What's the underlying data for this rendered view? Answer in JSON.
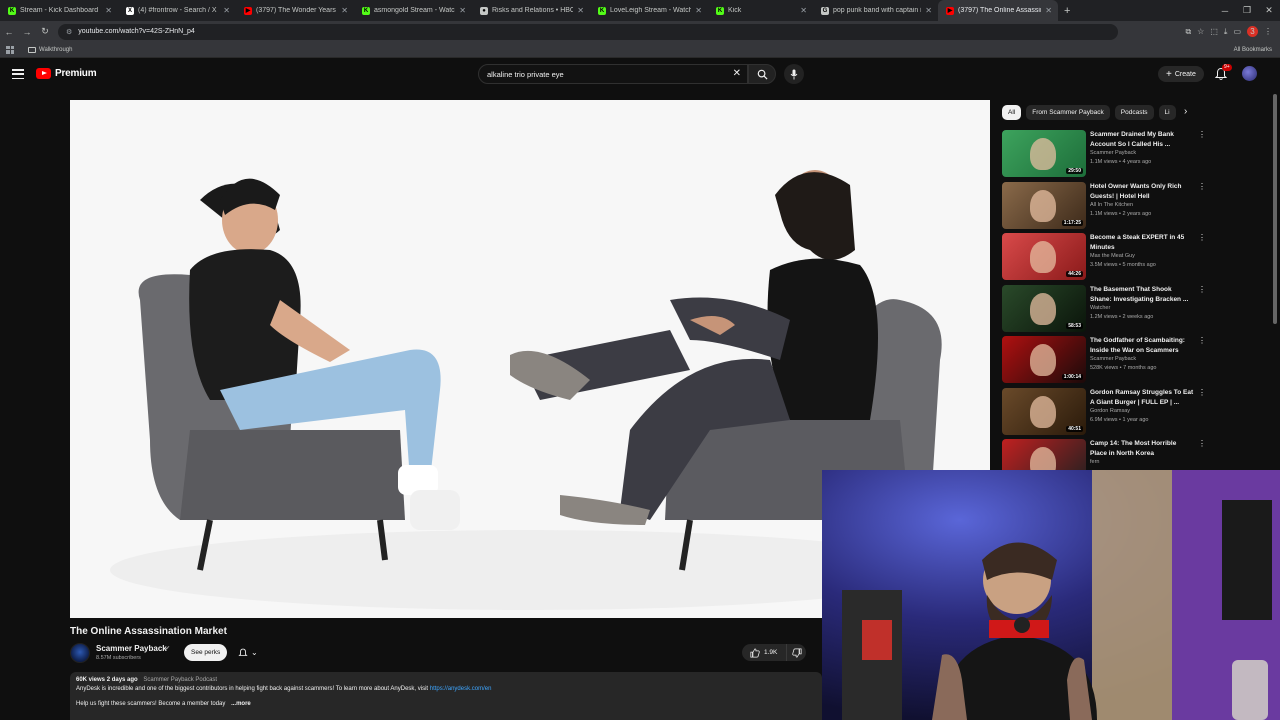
{
  "browser": {
    "tabs": [
      {
        "label": "Stream - Kick Dashboard",
        "fav_color": "#53fc18",
        "fav_char": "K"
      },
      {
        "label": "(4) #frontrow - Search / X",
        "fav_color": "#ffffff",
        "fav_char": "X"
      },
      {
        "label": "(3797) The Wonder Years - Loca",
        "fav_color": "#ff0000",
        "fav_char": "▶"
      },
      {
        "label": "asmongold Stream - Watch Live",
        "fav_color": "#53fc18",
        "fav_char": "K"
      },
      {
        "label": "Risks and Relations • HBO Max",
        "fav_color": "#c4c7c5",
        "fav_char": "●"
      },
      {
        "label": "LoveLeigh Stream - Watch Live",
        "fav_color": "#53fc18",
        "fav_char": "K"
      },
      {
        "label": "Kick",
        "fav_color": "#53fc18",
        "fav_char": "K"
      },
      {
        "label": "pop punk band with captain in",
        "fav_color": "#c4c7c5",
        "fav_char": "G"
      },
      {
        "label": "(3797) The Online Assassin",
        "fav_color": "#ff0000",
        "fav_char": "▶"
      }
    ],
    "url": "youtube.com/watch?v=42S-ZHnN_p4",
    "bookmark_folder": "Walkthrough",
    "all_bookmarks": "All Bookmarks",
    "profile_badge": "3"
  },
  "youtube": {
    "logo_text": "Premium",
    "search_query": "alkaline trio private eye",
    "create_label": "Create",
    "notif_badge": "9+",
    "video": {
      "title": "The Online Assassination Market",
      "channel": "Scammer Payback",
      "subscribers": "8.57M subscribers",
      "perks_label": "See perks",
      "likes": "1.9K",
      "views": "60K views",
      "age": "2 days ago",
      "podcast_tag": "Scammer Payback Podcast",
      "desc_line1": "AnyDesk is incredible and one of the biggest contributors in helping fight back against scammers! To learn more about AnyDesk, visit",
      "desc_link": "https://anydesk.com/en",
      "desc_line2": "Help us fight these scammers! Become a member today",
      "more_label": "...more"
    },
    "chips": [
      "All",
      "From Scammer Payback",
      "Podcasts",
      "Li"
    ],
    "recommendations": [
      {
        "title": "Scammer Drained My Bank Account So I Called His ...",
        "channel": "Scammer Payback",
        "meta": "1.1M views • 4 years ago",
        "duration": "29:50",
        "colors": [
          "#3da35d",
          "#1d6e3a"
        ]
      },
      {
        "title": "Hotel Owner Wants Only Rich Guests! | Hotel Hell",
        "channel": "All In The Kitchen",
        "meta": "1.1M views • 2 years ago",
        "duration": "1:17:25",
        "colors": [
          "#8a6a4a",
          "#3d2a1a"
        ]
      },
      {
        "title": "Become a Steak EXPERT in 45 Minutes",
        "channel": "Max the Meat Guy",
        "meta": "3.5M views • 5 months ago",
        "duration": "44:26",
        "colors": [
          "#d94a4a",
          "#8a1a1a"
        ]
      },
      {
        "title": "The Basement That Shook Shane: Investigating Bracken ...",
        "channel": "Watcher",
        "meta": "1.2M views • 2 weeks ago",
        "duration": "58:53",
        "colors": [
          "#2a4a2a",
          "#0a140a"
        ]
      },
      {
        "title": "The Godfather of Scambaiting: Inside the War on Scammers",
        "channel": "Scammer Payback",
        "meta": "528K views • 7 months ago",
        "duration": "1:00:14",
        "colors": [
          "#b01010",
          "#1a0a0a"
        ]
      },
      {
        "title": "Gordon Ramsay Struggles To Eat A Giant Burger | FULL EP | ...",
        "channel": "Gordon Ramsay",
        "meta": "6.9M views • 1 year ago",
        "duration": "40:51",
        "colors": [
          "#6a4a2a",
          "#2a1a0a"
        ]
      },
      {
        "title": "Camp 14: The Most Horrible Place in North Korea",
        "channel": "fern",
        "meta": "",
        "duration": "",
        "colors": [
          "#c02020",
          "#202020"
        ]
      }
    ]
  }
}
